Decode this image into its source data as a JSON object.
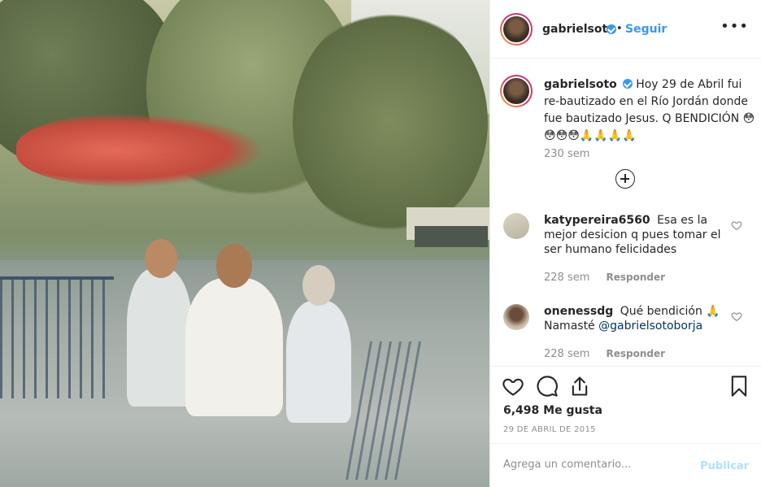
{
  "header": {
    "username": "gabrielsoto",
    "dot": "•",
    "follow_label": "Seguir",
    "more_icon": "more-options-icon",
    "more_label": "•••"
  },
  "caption": {
    "username": "gabrielsoto",
    "text": "Hoy 29 de Abril fui re-bautizado en el Río Jordán donde fue bautizado Jesus. Q BENDICIÓN 😳😳😳😳🙏🙏🙏🙏",
    "time": "230 sem"
  },
  "comments": [
    {
      "username": "katypereira6560",
      "text": "Esa es la mejor desicion q pues tomar el ser humano felicidades",
      "time": "228 sem",
      "reply_label": "Responder"
    },
    {
      "username": "onenessdg",
      "text": "Qué bendición 🙏",
      "mention": "@gabrielsotoborja",
      "text_before_mention": "Namasté ",
      "time": "228 sem",
      "reply_label": "Responder"
    }
  ],
  "actions": {
    "likes": "6,498 Me gusta",
    "date": "29 DE ABRIL DE 2015"
  },
  "add_comment": {
    "placeholder": "Agrega un comentario...",
    "publish_label": "Publicar"
  },
  "colors": {
    "accent": "#3897f0",
    "muted": "#8e8e8e",
    "publish_disabled": "#b2dffc"
  }
}
